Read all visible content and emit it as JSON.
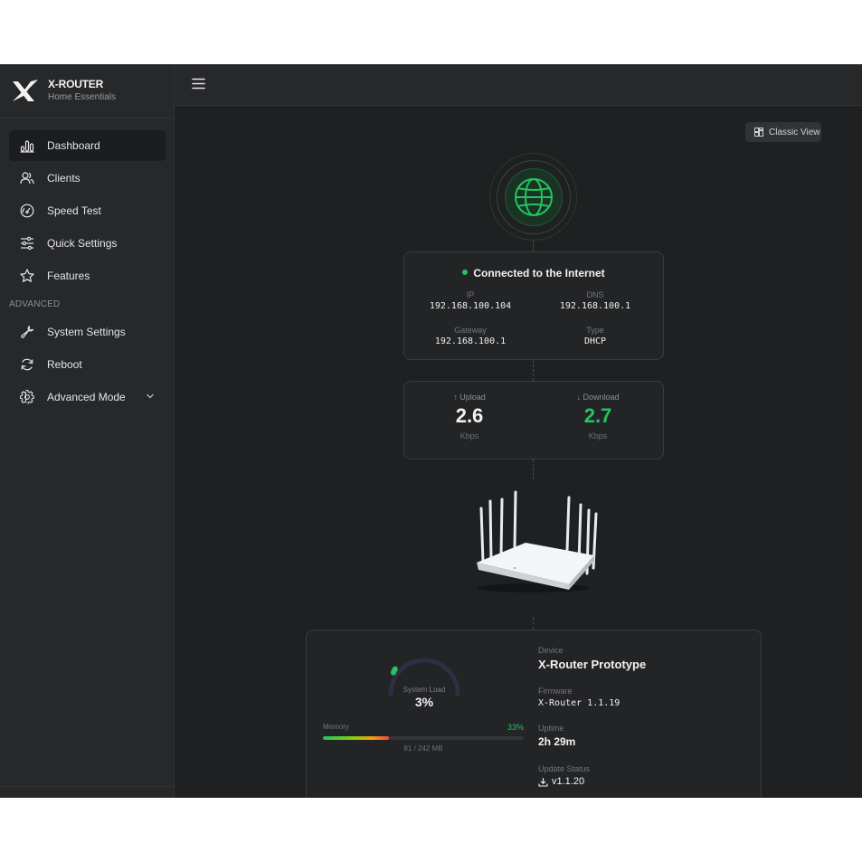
{
  "brand": {
    "name": "X-ROUTER",
    "subtitle": "Home Essentials"
  },
  "sidebar": {
    "items": [
      {
        "label": "Dashboard",
        "icon": "chart-bars-icon",
        "active": true
      },
      {
        "label": "Clients",
        "icon": "users-icon"
      },
      {
        "label": "Speed Test",
        "icon": "speedometer-icon"
      },
      {
        "label": "Quick Settings",
        "icon": "sliders-icon"
      },
      {
        "label": "Features",
        "icon": "star-icon"
      }
    ],
    "section_label": "ADVANCED",
    "advanced_items": [
      {
        "label": "System Settings",
        "icon": "wrench-icon"
      },
      {
        "label": "Reboot",
        "icon": "refresh-icon"
      },
      {
        "label": "Advanced Mode",
        "icon": "gear-icon"
      }
    ]
  },
  "toolbar": {
    "classic_view_label": "Classic View"
  },
  "connection": {
    "status": "Connected to the Internet",
    "ip_label": "IP",
    "ip": "192.168.100.104",
    "dns_label": "DNS",
    "dns": "192.168.100.1",
    "gateway_label": "Gateway",
    "gateway": "192.168.100.1",
    "type_label": "Type",
    "type": "DHCP"
  },
  "speed": {
    "upload_label": "Upload",
    "upload": "2.6",
    "upload_unit": "Kbps",
    "download_label": "Download",
    "download": "2.7",
    "download_unit": "Kbps"
  },
  "system": {
    "load_label": "System Load",
    "load": "3%",
    "load_fraction": 0.03,
    "memory_label": "Memory",
    "memory_pct": "33%",
    "memory_fraction": 0.33,
    "memory_detail": "81 / 242 MB"
  },
  "device": {
    "device_label": "Device",
    "device": "X-Router Prototype",
    "firmware_label": "Firmware",
    "firmware": "X-Router 1.1.19",
    "uptime_label": "Uptime",
    "uptime": "2h 29m",
    "update_label": "Update Status",
    "update": "v1.1.20"
  },
  "colors": {
    "accent": "#22c55e",
    "background": "#1f2022",
    "sidebar": "#27282a"
  }
}
